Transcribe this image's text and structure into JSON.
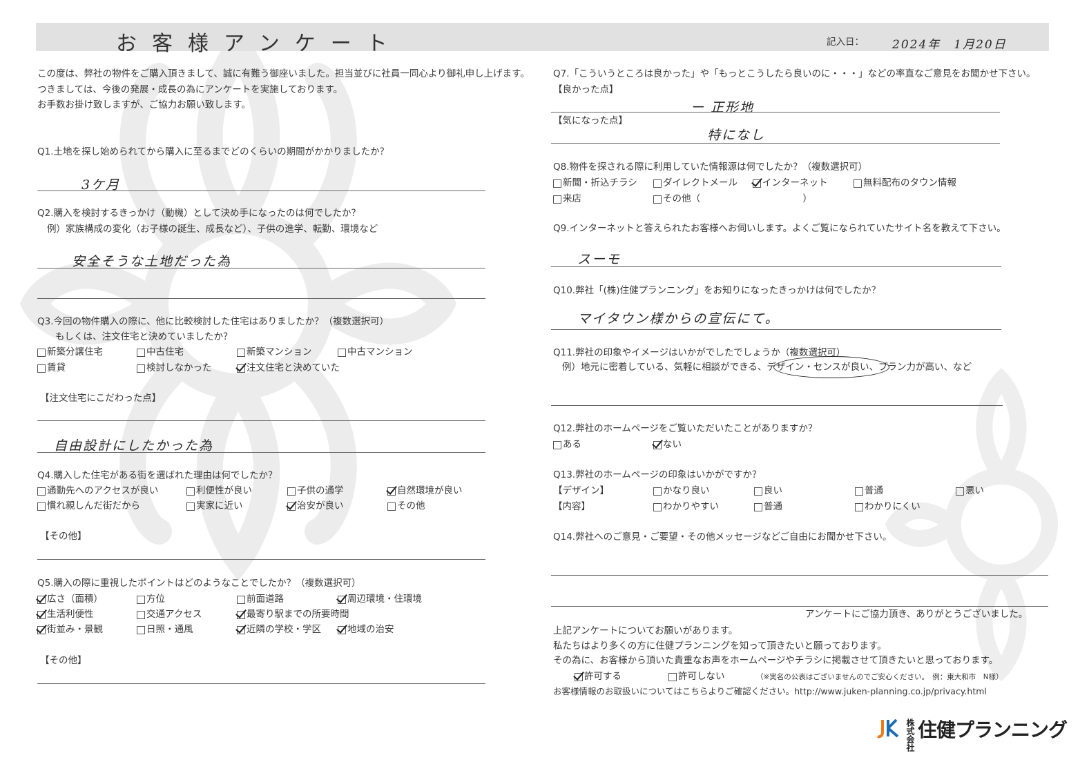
{
  "header": {
    "title": "お客様アンケート",
    "date_label": "記入日：",
    "date_value": "2024年　1月20日"
  },
  "intro": [
    "この度は、弊社の物件をご購入頂きまして、誠に有難う御座いました。担当並びに社員一同心より御礼申し上げます。",
    "つきましては、今後の発展・成長の為にアンケートを実施しております。",
    "お手数お掛け致しますが、ご協力お願い致します。"
  ],
  "q1": {
    "question": "Q1.土地を探し始められてから購入に至るまでどのくらいの期間がかかりましたか？",
    "answer": "3ケ月"
  },
  "q2": {
    "question": "Q2.購入を検討するきっかけ（動機）として決め手になったのは何でしたか？",
    "example": "例）家族構成の変化（お子様の誕生、成長など）、子供の進学、転勤、環境など",
    "answer": "安全そうな土地だった為"
  },
  "q3": {
    "question": "Q3.今回の物件購入の際に、他に比較検討した住宅はありましたか？（複数選択可）",
    "question2": "もしくは、注文住宅と決めていましたか？",
    "options": [
      {
        "label": "新築分譲住宅",
        "checked": false
      },
      {
        "label": "中古住宅",
        "checked": false
      },
      {
        "label": "新築マンション",
        "checked": false
      },
      {
        "label": "中古マンション",
        "checked": false
      },
      {
        "label": "賃貸",
        "checked": false
      },
      {
        "label": "検討しなかった",
        "checked": false
      },
      {
        "label": "注文住宅と決めていた",
        "checked": true
      }
    ],
    "custom_label": "【注文住宅にこだわった点】",
    "custom_answer": "自由設計にしたかった為"
  },
  "q4": {
    "question": "Q4.購入した住宅がある街を選ばれた理由は何でしたか？",
    "options": [
      {
        "label": "通勤先へのアクセスが良い",
        "checked": false
      },
      {
        "label": "利便性が良い",
        "checked": false
      },
      {
        "label": "子供の通学",
        "checked": false
      },
      {
        "label": "自然環境が良い",
        "checked": true
      },
      {
        "label": "慣れ親しんだ街だから",
        "checked": false
      },
      {
        "label": "実家に近い",
        "checked": false
      },
      {
        "label": "治安が良い",
        "checked": true
      },
      {
        "label": "その他",
        "checked": false
      }
    ],
    "other_label": "【その他】"
  },
  "q5": {
    "question": "Q5.購入の際に重視したポイントはどのようなことでしたか？（複数選択可）",
    "options": [
      {
        "label": "広さ（面積）",
        "checked": true
      },
      {
        "label": "方位",
        "checked": false
      },
      {
        "label": "前面道路",
        "checked": false
      },
      {
        "label": "周辺環境・住環境",
        "checked": true
      },
      {
        "label": "生活利便性",
        "checked": true
      },
      {
        "label": "交通アクセス",
        "checked": false
      },
      {
        "label": "最寄り駅までの所要時間",
        "checked": true
      },
      {
        "label": "街並み・景観",
        "checked": true
      },
      {
        "label": "日照・通風",
        "checked": false
      },
      {
        "label": "近隣の学校・学区",
        "checked": true
      },
      {
        "label": "地域の治安",
        "checked": true
      }
    ],
    "other_label": "【その他】"
  },
  "q7": {
    "question": "Q7.「こういうところは良かった」や「もっとこうしたら良いのに・・・」などの率直なご意見をお聞かせ下さい。",
    "good_label": "【良かった点】",
    "good_answer": "ー 正形地",
    "concern_label": "【気になった点】",
    "concern_answer": "特になし"
  },
  "q8": {
    "question": "Q8.物件を探される際に利用していた情報源は何でしたか？（複数選択可）",
    "options": [
      {
        "label": "新聞・折込チラシ",
        "checked": false
      },
      {
        "label": "ダイレクトメール",
        "checked": false
      },
      {
        "label": "インターネット",
        "checked": true
      },
      {
        "label": "無料配布のタウン情報",
        "checked": false
      },
      {
        "label": "来店",
        "checked": false
      },
      {
        "label": "その他（　　　　　　　　　　　）",
        "checked": false
      }
    ]
  },
  "q9": {
    "question": "Q9.インターネットと答えられたお客様へお伺いします。よくご覧になられていたサイト名を教えて下さい。",
    "answer": "スーモ"
  },
  "q10": {
    "question": "Q10.弊社「(株)住健プランニング」をお知りになったきっかけは何でしたか？",
    "answer": "マイタウン様からの宣伝にて。"
  },
  "q11": {
    "question": "Q11.弊社の印象やイメージはいかがでしたでしょうか（複数選択可）",
    "example_pre": "例）地元に密着している、気軽に相談ができる、",
    "example_circled": "デザイン・センスが良い",
    "example_post": "、プラン力が高い、など"
  },
  "q12": {
    "question": "Q12.弊社のホームページをご覧いただいたことがありますか？",
    "options": [
      {
        "label": "ある",
        "checked": false
      },
      {
        "label": "ない",
        "checked": true
      }
    ]
  },
  "q13": {
    "question": "Q13.弊社のホームページの印象はいかがですか？",
    "design_label": "【デザイン】",
    "design_options": [
      {
        "label": "かなり良い",
        "checked": false
      },
      {
        "label": "良い",
        "checked": false
      },
      {
        "label": "普通",
        "checked": false
      },
      {
        "label": "悪い",
        "checked": false
      }
    ],
    "content_label": "【内容】",
    "content_options": [
      {
        "label": "わかりやすい",
        "checked": false
      },
      {
        "label": "普通",
        "checked": false
      },
      {
        "label": "わかりにくい",
        "checked": false
      }
    ]
  },
  "q14": {
    "question": "Q14.弊社へのご意見・ご要望・その他メッセージなどご自由にお聞かせ下さい。"
  },
  "footer": {
    "thanks": "アンケートにご協力頂き、ありがとうございました。",
    "request_1": "上記アンケートについてお願いがあります。",
    "request_2": "私たちはより多くの方に住健プランニングを知って頂きたいと願っております。",
    "request_3": "その為に、お客様から頂いた貴重なお声をホームページやチラシに掲載させて頂きたいと思っております。",
    "permit_options": [
      {
        "label": "許可する",
        "checked": true
      },
      {
        "label": "許可しない",
        "checked": false
      }
    ],
    "note": "（※実名の公表はございませんのでご安心ください。　例：東大和市　N様）",
    "privacy": "お客様情報のお取扱いについてはこちらよりご確認ください。http://www.juken-planning.co.jp/privacy.html",
    "logo_small": "株式会社",
    "logo_text": "住健プランニング"
  }
}
